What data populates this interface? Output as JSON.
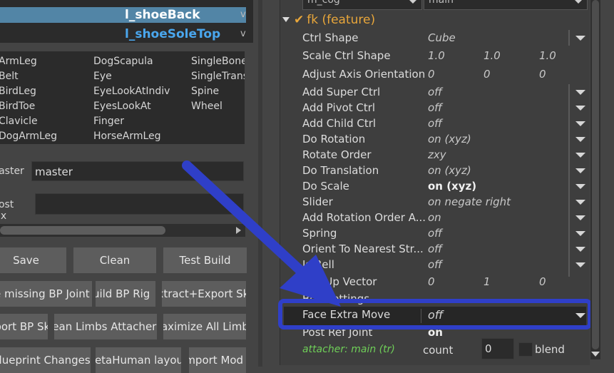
{
  "outliner": {
    "rows": [
      {
        "label": "l_shoeBack",
        "suffix": "v"
      },
      {
        "label": "l_shoeSoleTop",
        "suffix": "v"
      }
    ]
  },
  "bp_grid": {
    "col1": [
      "ArmLeg",
      "Belt",
      "BirdLeg",
      "BirdToe",
      "Clavicle",
      "DogArmLeg"
    ],
    "col2": [
      "DogScapula",
      "Eye",
      "EyeLookAtIndiv",
      "EyesLookAt",
      "Finger",
      "HorseArmLeg"
    ],
    "col3": [
      "SingleBone",
      "SingleTrans",
      "Spine",
      "Wheel"
    ]
  },
  "master": {
    "label": "Master",
    "value": "master"
  },
  "postfix": {
    "label": "Post Fix",
    "value": ""
  },
  "buttons": {
    "row1": [
      "Save",
      "Clean",
      "Test Build"
    ],
    "row2": [
      "Create missing BP Joint",
      "Build BP Rig",
      "Extract+Export Sk"
    ],
    "row3": [
      "Export BP Sk",
      "Clean Limbs Attacher",
      "Maximize All Limbs"
    ],
    "row4": [
      "Blueprint Changes",
      "MetaHuman layout",
      "Import Mod"
    ]
  },
  "top_combos": {
    "left": "m_cog",
    "right": "main"
  },
  "section": {
    "title": "fk (feature)"
  },
  "props": {
    "ctrl_shape": {
      "label": "Ctrl Shape",
      "value": "Cube"
    },
    "scale_ctrl_shape": {
      "label": "Scale Ctrl Shape",
      "x": "1.0",
      "y": "1.0",
      "z": "1.0"
    },
    "adjust_axis": {
      "label": "Adjust Axis Orientation",
      "x": "0",
      "y": "0",
      "z": "0"
    },
    "add_super": {
      "label": "Add Super Ctrl",
      "value": "off"
    },
    "add_pivot": {
      "label": "Add Pivot Ctrl",
      "value": "off"
    },
    "add_child": {
      "label": "Add Child Ctrl",
      "value": "off"
    },
    "do_rotation": {
      "label": "Do Rotation",
      "value": "on (xyz)"
    },
    "rotate_order": {
      "label": "Rotate Order",
      "value": "zxy"
    },
    "do_translation": {
      "label": "Do Translation",
      "value": "on (xyz)"
    },
    "do_scale": {
      "label": "Do Scale",
      "value": "on (xyz)"
    },
    "slider": {
      "label": "Slider",
      "value": "on negate right"
    },
    "add_rot_order": {
      "label": "Add Rotation Order A...",
      "value": "on"
    },
    "spring": {
      "label": "Spring",
      "value": "off"
    },
    "orient_nearest": {
      "label": "Orient To Nearest Str...",
      "value": "off"
    },
    "is_bell": {
      "label": "Is Bell",
      "value": "off"
    },
    "pull_up": {
      "label": "Pull Up Vector",
      "x": "0",
      "y": "1",
      "z": "0"
    },
    "bell_settings": {
      "label": "Bell Settings"
    },
    "face_extra": {
      "label": "Face Extra Move",
      "value": "off"
    },
    "post_ref": {
      "label": "Post Ref Joint",
      "value": "on"
    }
  },
  "attacher": {
    "label": "attacher: main (tr)",
    "count_label": "count",
    "count_value": "0",
    "blend_label": "blend"
  },
  "annotation": {
    "arrow_color": "#2f3fc8",
    "highlight_color": "#2f3fc8"
  }
}
